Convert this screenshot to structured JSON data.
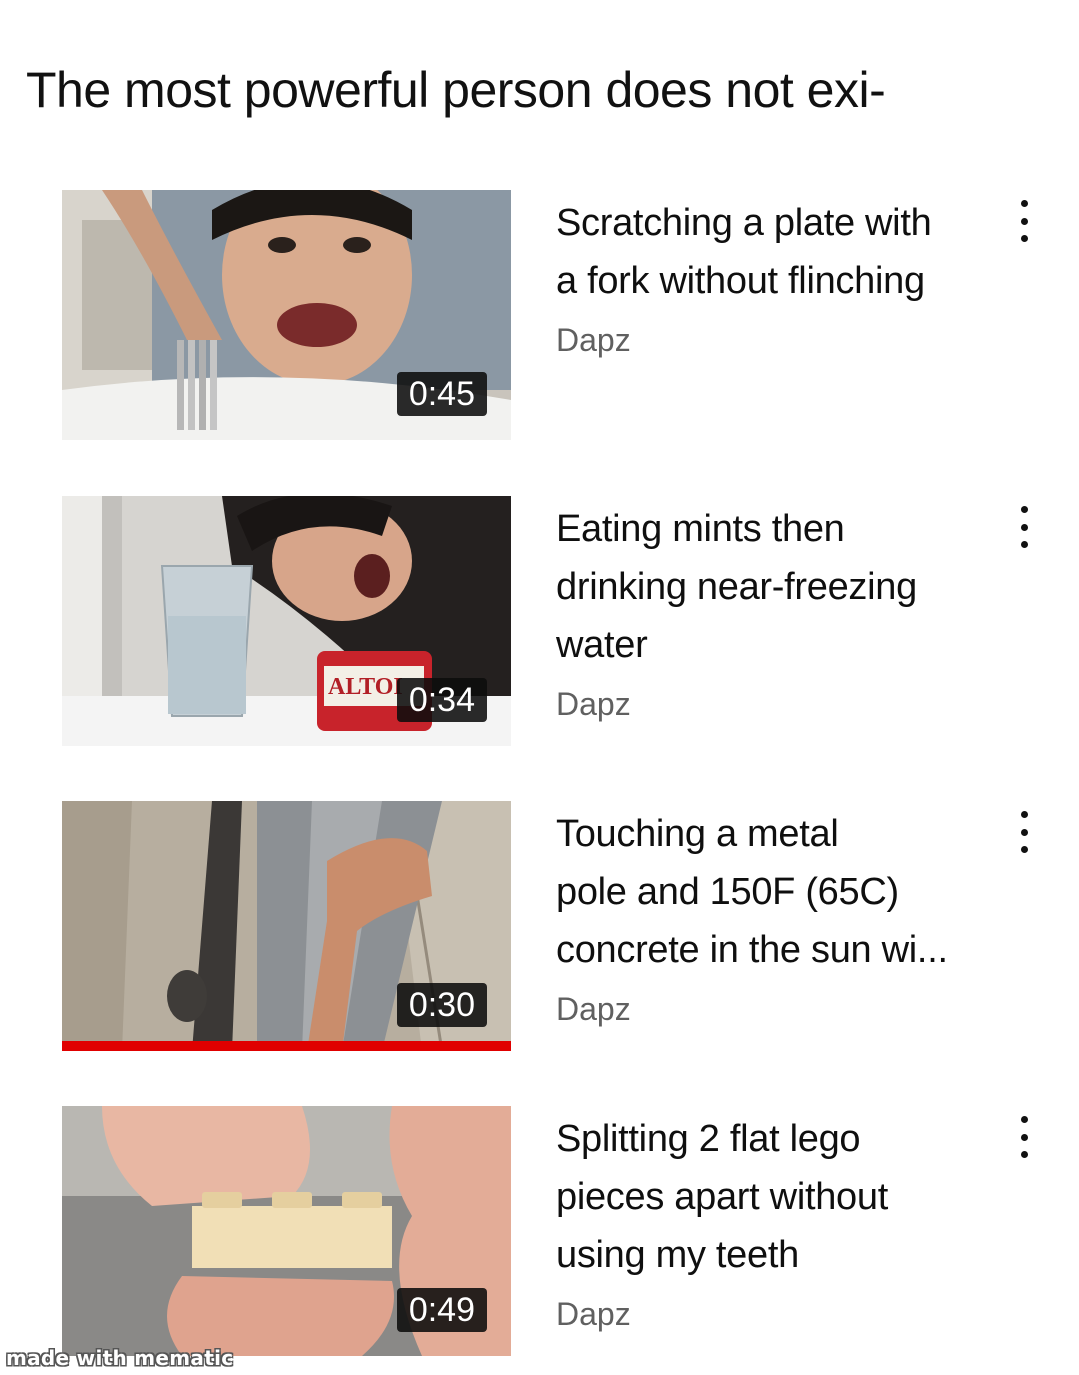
{
  "header": {
    "title": "The most powerful person does not exi-"
  },
  "videos": [
    {
      "title_lines": [
        "Scratching a plate with",
        "a fork without flinching"
      ],
      "channel": "Dapz",
      "duration": "0:45",
      "thumbnail_desc": "young man with fork scratching a white plate",
      "watched_fraction": 0
    },
    {
      "title_lines": [
        "Eating mints then",
        "drinking near-freezing",
        "water"
      ],
      "channel": "Dapz",
      "duration": "0:34",
      "thumbnail_text": "ALTOI",
      "thumbnail_desc": "young man next to glass of water and red mint tin",
      "watched_fraction": 0
    },
    {
      "title_lines": [
        "Touching a metal",
        "pole and 150F (65C)",
        "concrete in the sun wi..."
      ],
      "channel": "Dapz",
      "duration": "0:30",
      "thumbnail_desc": "hand touching a metal pole on concrete",
      "watched_fraction": 1.0
    },
    {
      "title_lines": [
        "Splitting 2 flat lego",
        "pieces apart without",
        "using my teeth"
      ],
      "channel": "Dapz",
      "duration": "0:49",
      "thumbnail_desc": "fingers holding a beige lego brick",
      "watched_fraction": 0
    }
  ],
  "icons": {
    "more": "more-vert-icon"
  },
  "colors": {
    "progress": "#e00000",
    "channel_text": "#606060",
    "duration_bg": "#0c0c0c"
  },
  "watermark": "made with mematic"
}
